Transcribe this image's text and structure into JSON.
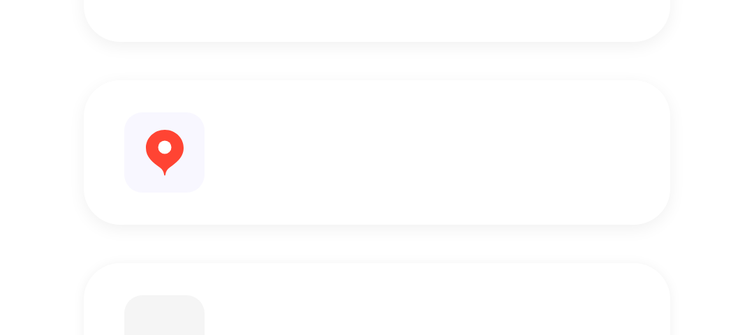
{
  "cards": [
    {
      "kind": "empty"
    },
    {
      "kind": "pin"
    },
    {
      "kind": "loading"
    }
  ]
}
